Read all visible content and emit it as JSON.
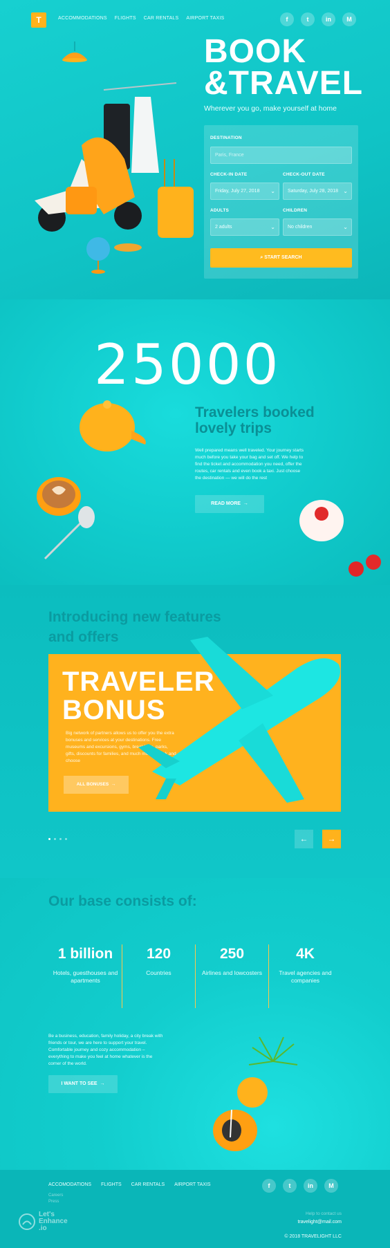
{
  "brand": {
    "logo_letter": "T"
  },
  "nav": {
    "items": [
      "ACCOMMODATIONS",
      "FLIGHTS",
      "CAR RENTALS",
      "AIRPORT TAXIS"
    ]
  },
  "social": [
    "f",
    "t",
    "in",
    "M"
  ],
  "hero": {
    "title_line1": "BOOK",
    "title_line2": "&TRAVEL",
    "subtitle": "Wherever you go, make yourself at home"
  },
  "booking": {
    "destination_label": "DESTINATION",
    "destination_placeholder": "Paris, France",
    "checkin_label": "CHECK-IN DATE",
    "checkin_value": "Friday, July 27, 2018",
    "checkout_label": "CHECK-OUT DATE",
    "checkout_value": "Saturday, July 28, 2018",
    "adults_label": "ADULTS",
    "adults_value": "2 adults",
    "children_label": "CHILDREN",
    "children_value": "No children",
    "search_label": "START SEARCH"
  },
  "stats_hero": {
    "number": "25000",
    "title_line1": "Travelers booked",
    "title_line2": "lovely trips",
    "text": "Well prepared means well traveled. Your journey starts much before you take your bag and set off. We help to find the ticket and accommodation you need, offer the routes, car rentals and even book a taxi. Just choose the destination — we will do the rest",
    "button": "READ MORE"
  },
  "features": {
    "title_line1": "Introducing new features",
    "title_line2": "and offers",
    "bonus_line1": "TRAVELER",
    "bonus_line2": "BONUS",
    "bonus_text": "Big network of partners allows us to offer you the extra bonuses and services at your destinations. Free museums and excursions, gyms, breakfasts, parks, gifts, discounts for families, and much more. Check and choose",
    "bonus_button": "ALL BONUSES",
    "prev_label": "←",
    "next_label": "→"
  },
  "base": {
    "title": "Our base consists of:",
    "stats": [
      {
        "value": "1 billion",
        "label": "Hotels, guesthouses and apartments"
      },
      {
        "value": "120",
        "label": "Countries"
      },
      {
        "value": "250",
        "label": "Airlines and lowcosters"
      },
      {
        "value": "4K",
        "label": "Travel agencies and companies"
      }
    ],
    "text": "Be a business, education, family holiday, a city break with friends or tour, we are here to support your travel. Comfortable journey and cozy accommodation – everything to make you feel at home whatever is the corner of the world.",
    "button": "I WANT TO SEE"
  },
  "footer": {
    "nav": [
      "ACCOMODATIONS",
      "FLIGHTS",
      "CAR RENTALS",
      "AIRPORT TAXIS"
    ],
    "sub_links": [
      "Careers",
      "Press"
    ],
    "contact_label": "Help to contact us",
    "email": "travelight@mail.com",
    "copyright": "© 2018 TRAVELIGHT LLC",
    "watermark_line1": "Let's",
    "watermark_line2": "Enhance",
    "watermark_line3": ".io"
  },
  "colors": {
    "teal": "#0fc7c9",
    "accent": "#ffb21c",
    "dark_teal_text": "#0a9ba0"
  }
}
